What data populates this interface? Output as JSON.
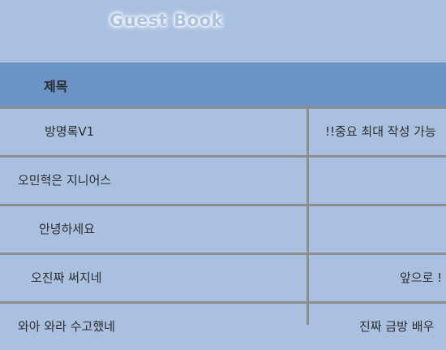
{
  "app": {
    "title": "Guest Book"
  },
  "table": {
    "header": {
      "title_label": "제목"
    },
    "rows": [
      {
        "title": "방명록V1",
        "content": "!!중요 최대 작성 가능"
      },
      {
        "title": "오민혁은 지니어스",
        "content": ""
      },
      {
        "title": "안녕하세요",
        "content": ""
      },
      {
        "title": "오진짜 써지네",
        "content": "앞으로 !"
      },
      {
        "title": "와아 와라 수고했네",
        "content": "진짜 금방 배우"
      }
    ]
  },
  "colors": {
    "background": "#aac0e0",
    "header_bar": "#6b93c6",
    "grid_lines": "#8e8e8e"
  }
}
